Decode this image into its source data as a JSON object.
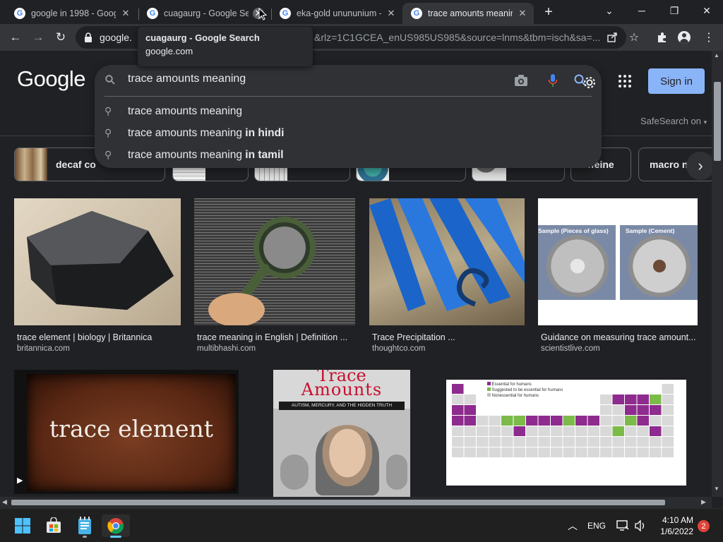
{
  "browser": {
    "tabs": [
      {
        "title": "google in 1998 - Googl",
        "active": false
      },
      {
        "title": "cuagaurg - Google Sea",
        "active": false
      },
      {
        "title": "eka-gold unununium -",
        "active": false
      },
      {
        "title": "trace amounts meaning",
        "active": true
      }
    ],
    "new_tab_symbol": "+",
    "url": "google.",
    "url_rest": "&rlz=1C1GCEA_enUS985US985&source=lnms&tbm=isch&sa=...",
    "tooltip": {
      "title": "cuagaurg - Google Search",
      "domain": "google.com"
    }
  },
  "header": {
    "logo": "Google",
    "query": "trace amounts meaning",
    "suggestions": [
      {
        "base": "trace amounts meaning",
        "suffix": ""
      },
      {
        "base": "trace amounts meaning",
        "suffix": "in hindi"
      },
      {
        "base": "trace amounts meaning",
        "suffix": "in tamil"
      }
    ],
    "sign_in": "Sign in",
    "safesearch": "SafeSearch on"
  },
  "chips": [
    {
      "label": "decaf co"
    },
    {
      "label": ""
    },
    {
      "label": ""
    },
    {
      "label": ""
    },
    {
      "label": ""
    },
    {
      "label": "ffeine"
    },
    {
      "label": "macro n"
    }
  ],
  "results": [
    {
      "caption": "trace element | biology | Britannica",
      "source": "britannica.com"
    },
    {
      "caption": "trace meaning in English | Definition ...",
      "source": "multibhashi.com"
    },
    {
      "caption": "Trace Precipitation ...",
      "source": "thoughtco.com"
    },
    {
      "caption": "Guidance on measuring trace amount...",
      "source": "scientistlive.com"
    }
  ],
  "result_images": {
    "trace_element_text": "trace element",
    "book_title_1": "Trace",
    "book_title_2": "Amounts",
    "book_subtitle": "AUTISM, MERCURY, AND THE HIDDEN TRUTH",
    "glass_label_1": "Sample (Pieces of glass)",
    "glass_label_2": "Sample (Cement)",
    "legend": [
      "Essential for humans",
      "Suggested to be essential for humans",
      "Nonessential for humans"
    ]
  },
  "taskbar": {
    "lang": "ENG",
    "time": "4:10 AM",
    "date": "1/6/2022",
    "notifications": "2"
  },
  "colors": {
    "page_bg": "#202124",
    "accent_blue": "#8ab4f8",
    "essential": "#8e2b8e",
    "suggested": "#7cbb4a"
  }
}
